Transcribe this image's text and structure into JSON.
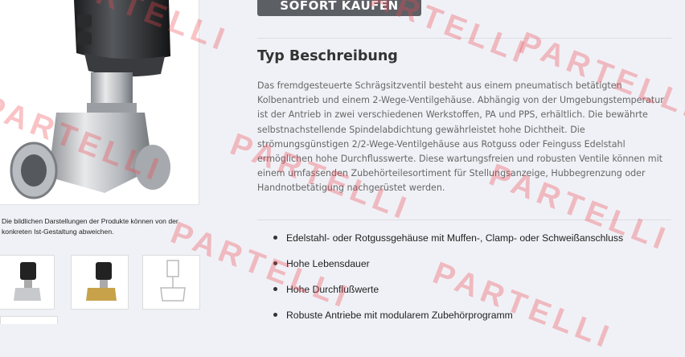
{
  "product": {
    "cta_label": "SOFORT KAUFEN",
    "disclaimer": "Die bildlichen Darstellungen der Produkte können von der konkreten Ist-Gestaltung abweichen.",
    "thumbnails": [
      {
        "name": "thumbnail-valve-stainless"
      },
      {
        "name": "thumbnail-valve-brass"
      },
      {
        "name": "thumbnail-valve-drawing"
      }
    ]
  },
  "description_section": {
    "title": "Typ Beschreibung",
    "text": "Das fremdgesteuerte Schrägsitzventil besteht aus einem pneumatisch betätigten Kolbenantrieb und einem 2-Wege-Ventilgehäuse. Abhängig von der Umgebungstemperatur ist der Antrieb in zwei verschiedenen Werkstoffen, PA und PPS, erhältlich. Die bewährte selbstnachstellende Spindelabdichtung gewährleistet hohe Dichtheit. Die strömungsgünstigen 2/2-Wege-Ventilgehäuse aus Rotguss oder Feinguss Edelstahl ermöglichen hohe Durchflusswerte. Diese wartungsfreien und robusten Ventile können mit einem umfassenden Zubehörteilesortiment für Stellungsanzeige, Hubbegrenzung oder Handnotbetätigung nachgerüstet werden."
  },
  "features": [
    "Edelstahl- oder Rotgussgehäuse mit Muffen-, Clamp- oder Schweißanschluss",
    "Hohe Lebensdauer",
    "Hohe Durchflußwerte",
    "Robuste Antriebe mit modularem Zubehörprogramm"
  ],
  "watermark": {
    "text": "PARTELLI",
    "color": "#ec4852"
  },
  "colors": {
    "button": "#5c5f64",
    "background": "#f0f1f6"
  }
}
